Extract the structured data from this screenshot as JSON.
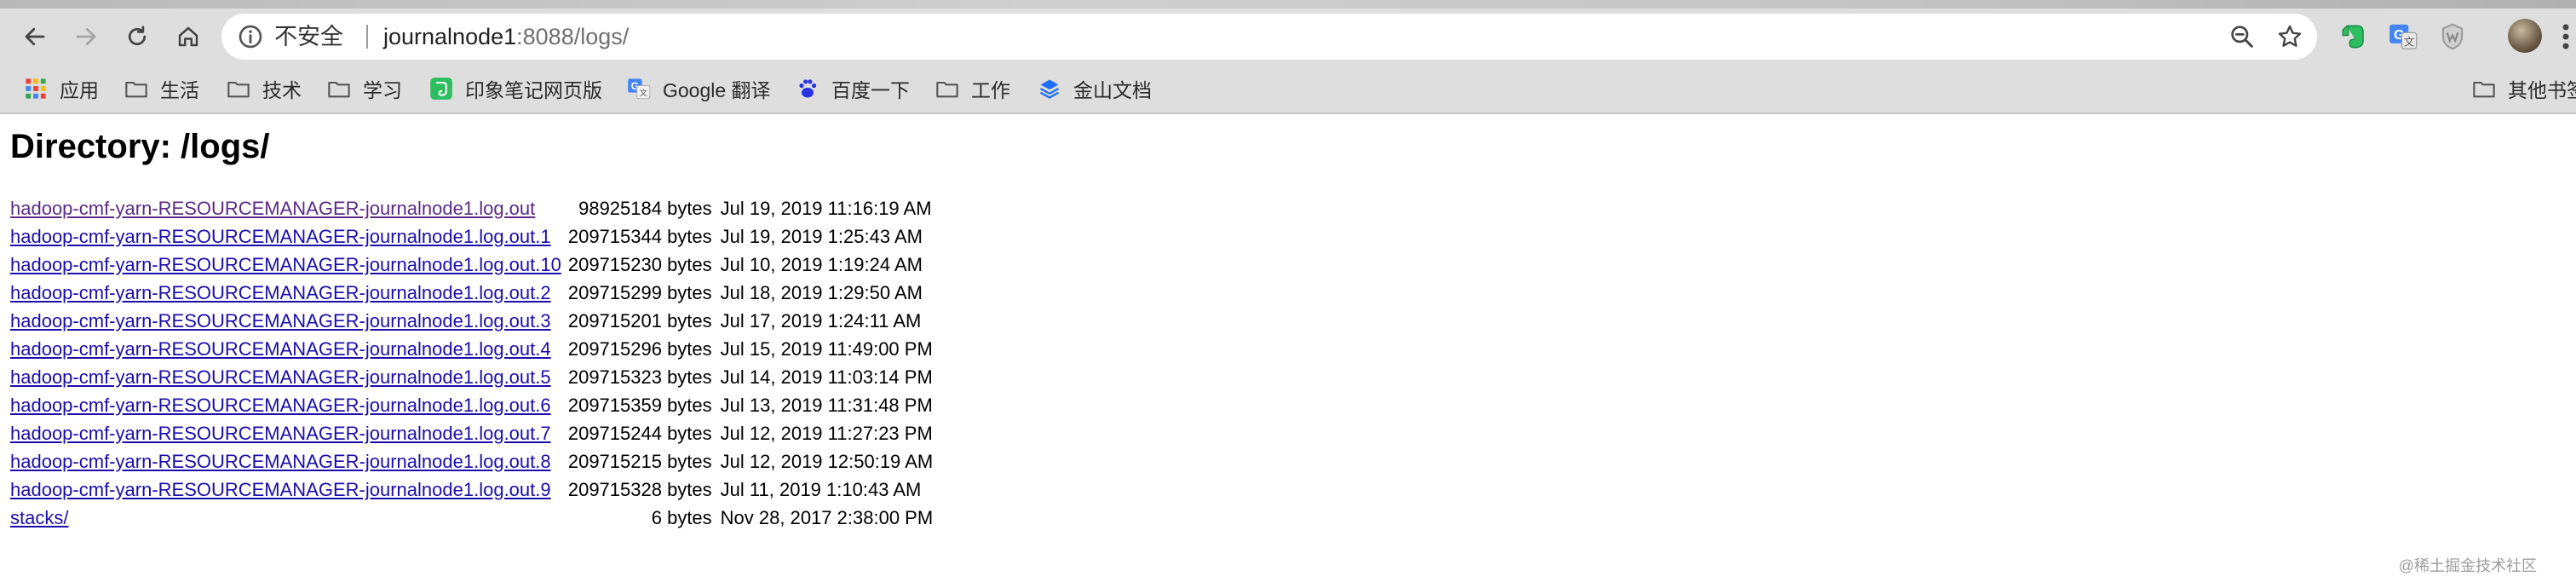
{
  "browser": {
    "security_label": "不安全",
    "url_host": "journalnode1",
    "url_rest": ":8088/logs/"
  },
  "bookmarks": [
    {
      "label": "应用",
      "icon": "apps-grid-icon"
    },
    {
      "label": "生活",
      "icon": "folder-icon"
    },
    {
      "label": "技术",
      "icon": "folder-icon"
    },
    {
      "label": "学习",
      "icon": "folder-icon"
    },
    {
      "label": "印象笔记网页版",
      "icon": "evernote-icon"
    },
    {
      "label": "Google 翻译",
      "icon": "google-translate-icon"
    },
    {
      "label": "百度一下",
      "icon": "baidu-icon"
    },
    {
      "label": "工作",
      "icon": "folder-icon"
    },
    {
      "label": "金山文档",
      "icon": "kingsoft-docs-icon"
    }
  ],
  "other_bookmarks": "其他书签",
  "page": {
    "title": "Directory: /logs/",
    "entries": [
      {
        "name": "hadoop-cmf-yarn-RESOURCEMANAGER-journalnode1.log.out",
        "size": "98925184 bytes",
        "date": "Jul 19, 2019 11:16:19 AM"
      },
      {
        "name": "hadoop-cmf-yarn-RESOURCEMANAGER-journalnode1.log.out.1",
        "size": "209715344 bytes",
        "date": "Jul 19, 2019 1:25:43 AM"
      },
      {
        "name": "hadoop-cmf-yarn-RESOURCEMANAGER-journalnode1.log.out.10",
        "size": "209715230 bytes",
        "date": "Jul 10, 2019 1:19:24 AM"
      },
      {
        "name": "hadoop-cmf-yarn-RESOURCEMANAGER-journalnode1.log.out.2",
        "size": "209715299 bytes",
        "date": "Jul 18, 2019 1:29:50 AM"
      },
      {
        "name": "hadoop-cmf-yarn-RESOURCEMANAGER-journalnode1.log.out.3",
        "size": "209715201 bytes",
        "date": "Jul 17, 2019 1:24:11 AM"
      },
      {
        "name": "hadoop-cmf-yarn-RESOURCEMANAGER-journalnode1.log.out.4",
        "size": "209715296 bytes",
        "date": "Jul 15, 2019 11:49:00 PM"
      },
      {
        "name": "hadoop-cmf-yarn-RESOURCEMANAGER-journalnode1.log.out.5",
        "size": "209715323 bytes",
        "date": "Jul 14, 2019 11:03:14 PM"
      },
      {
        "name": "hadoop-cmf-yarn-RESOURCEMANAGER-journalnode1.log.out.6",
        "size": "209715359 bytes",
        "date": "Jul 13, 2019 11:31:48 PM"
      },
      {
        "name": "hadoop-cmf-yarn-RESOURCEMANAGER-journalnode1.log.out.7",
        "size": "209715244 bytes",
        "date": "Jul 12, 2019 11:27:23 PM"
      },
      {
        "name": "hadoop-cmf-yarn-RESOURCEMANAGER-journalnode1.log.out.8",
        "size": "209715215 bytes",
        "date": "Jul 12, 2019 12:50:19 AM"
      },
      {
        "name": "hadoop-cmf-yarn-RESOURCEMANAGER-journalnode1.log.out.9",
        "size": "209715328 bytes",
        "date": "Jul 11, 2019 1:10:43 AM"
      },
      {
        "name": "stacks/",
        "size": "6 bytes",
        "date": "Nov 28, 2017 2:38:00 PM"
      }
    ]
  },
  "watermark": "@稀土掘金技术社区",
  "colors": {
    "link": "#1a0dab",
    "visited_link": "#5b2a86",
    "chrome_bg": "#dedede"
  }
}
